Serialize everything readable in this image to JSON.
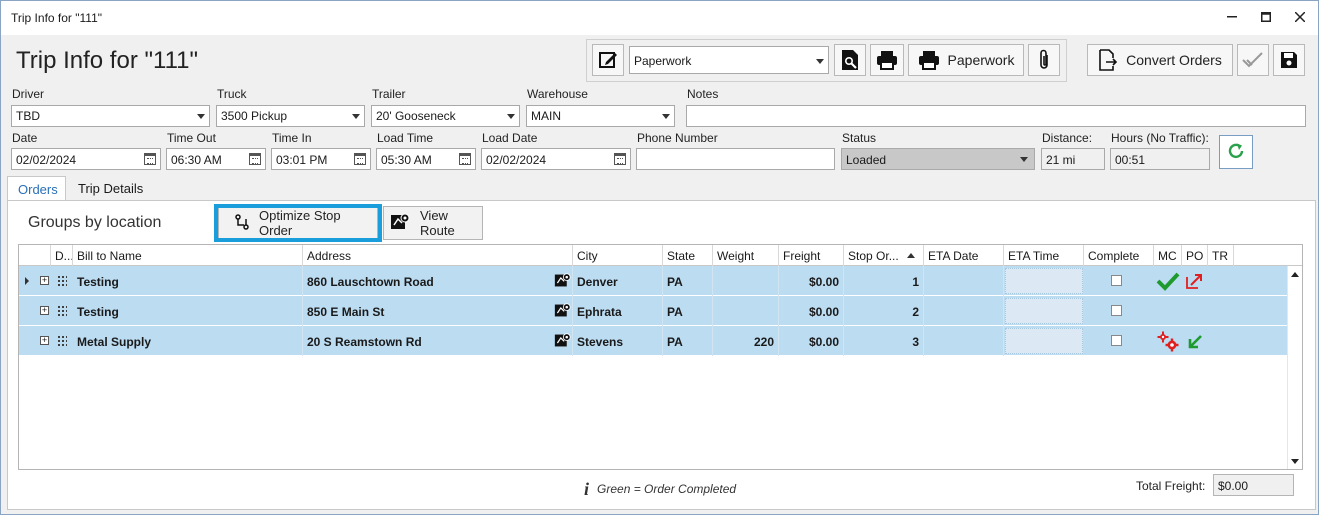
{
  "window": {
    "title": "Trip Info for \"111\""
  },
  "header": {
    "title": "Trip Info for \"111\""
  },
  "toolbar": {
    "report_select": "Paperwork",
    "paperwork_label": "Paperwork",
    "convert_orders_label": "Convert Orders"
  },
  "form": {
    "driver": {
      "label": "Driver",
      "value": "TBD"
    },
    "truck": {
      "label": "Truck",
      "value": "3500 Pickup"
    },
    "trailer": {
      "label": "Trailer",
      "value": "20' Gooseneck"
    },
    "warehouse": {
      "label": "Warehouse",
      "value": "MAIN"
    },
    "notes": {
      "label": "Notes",
      "value": ""
    },
    "date": {
      "label": "Date",
      "value": "02/02/2024"
    },
    "time_out": {
      "label": "Time Out",
      "value": "06:30 AM"
    },
    "time_in": {
      "label": "Time In",
      "value": "03:01 PM"
    },
    "load_time": {
      "label": "Load Time",
      "value": "05:30 AM"
    },
    "load_date": {
      "label": "Load Date",
      "value": "02/02/2024"
    },
    "phone": {
      "label": "Phone Number",
      "value": ""
    },
    "status": {
      "label": "Status",
      "value": "Loaded"
    },
    "distance": {
      "label": "Distance:",
      "value": "21 mi"
    },
    "hours": {
      "label": "Hours (No Traffic):",
      "value": "00:51"
    }
  },
  "tabs": [
    {
      "label": "Orders"
    },
    {
      "label": "Trip Details"
    }
  ],
  "orders": {
    "groups_label": "Groups by location",
    "optimize_label": "Optimize Stop Order",
    "view_route_label": "View Route",
    "columns": [
      "D...",
      "Bill to Name",
      "Address",
      "City",
      "State",
      "Weight",
      "Freight",
      "Stop Or...",
      "ETA Date",
      "ETA Time",
      "Complete",
      "MC",
      "PO",
      "TR"
    ],
    "rows": [
      {
        "bill_to": "Testing",
        "address": "860 Lauschtown Road",
        "city": "Denver",
        "state": "PA",
        "weight": "",
        "freight": "$0.00",
        "stop": "1",
        "mc": "check",
        "po": "export"
      },
      {
        "bill_to": "Testing",
        "address": "850 E Main St",
        "city": "Ephrata",
        "state": "PA",
        "weight": "",
        "freight": "$0.00",
        "stop": "2",
        "mc": "",
        "po": ""
      },
      {
        "bill_to": "Metal Supply",
        "address": "20 S Reamstown Rd",
        "city": "Stevens",
        "state": "PA",
        "weight": "220",
        "freight": "$0.00",
        "stop": "3",
        "mc": "gears",
        "po": "import"
      }
    ],
    "note": "Green = Order Completed",
    "total_freight_label": "Total Freight:",
    "total_freight_value": "$0.00"
  }
}
